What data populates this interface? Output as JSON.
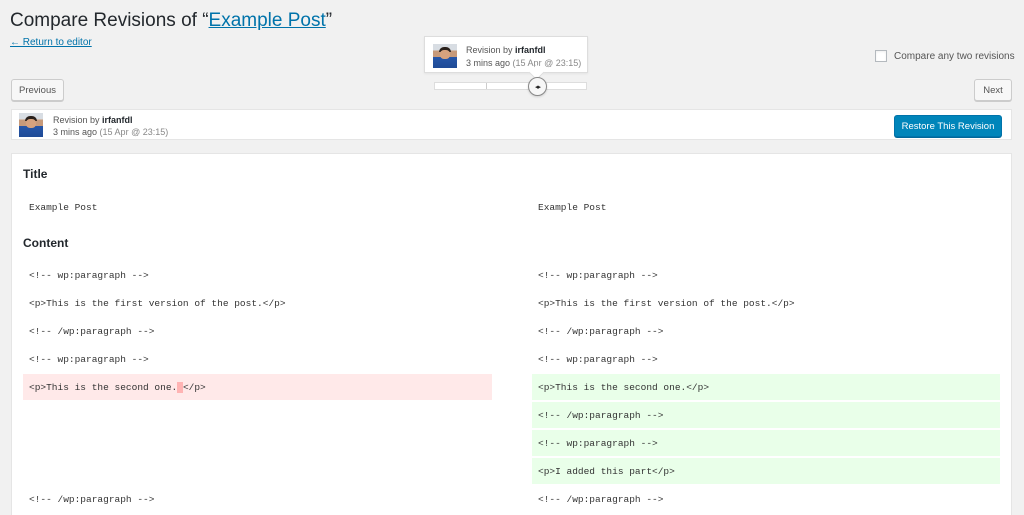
{
  "header": {
    "title_prefix": "Compare Revisions of “",
    "title_link": "Example Post",
    "title_suffix": "”",
    "return_link": "← Return to editor"
  },
  "tooltip": {
    "revision_by_prefix": "Revision by ",
    "author": "irfanfdl",
    "time_ago": "3 mins ago",
    "date": "(15 Apr @ 23:15)"
  },
  "controls": {
    "compare_two_label": "Compare any two revisions",
    "compare_two_checked": false,
    "previous_label": "Previous",
    "next_label": "Next",
    "slider_handle_glyph": "◂▸"
  },
  "meta": {
    "revision_by_prefix": "Revision by ",
    "author": "irfanfdl",
    "time_ago": "3 mins ago",
    "date": "(15 Apr @ 23:15)",
    "restore_label": "Restore This Revision"
  },
  "diff": {
    "title_heading": "Title",
    "title_left": "Example Post",
    "title_right": "Example Post",
    "content_heading": "Content",
    "left": [
      "<!-- wp:paragraph -->",
      "<p>This is the first version of the post.</p>",
      "<!-- /wp:paragraph -->",
      "<!-- wp:paragraph -->",
      "<p>This is the second one.",
      "</p>",
      "<!-- /wp:paragraph -->"
    ],
    "right": [
      "<!-- wp:paragraph -->",
      "<p>This is the first version of the post.</p>",
      "<!-- /wp:paragraph -->",
      "<!-- wp:paragraph -->",
      "<p>This is the second one.</p>",
      "<!-- /wp:paragraph -->",
      "<!-- wp:paragraph -->",
      "<p>I added this part</p>",
      "<!-- /wp:paragraph -->"
    ]
  },
  "colors": {
    "link": "#0073aa",
    "primary_button": "#0085ba",
    "deleted_bg": "#ffe9e9",
    "added_bg": "#e9ffe9"
  }
}
